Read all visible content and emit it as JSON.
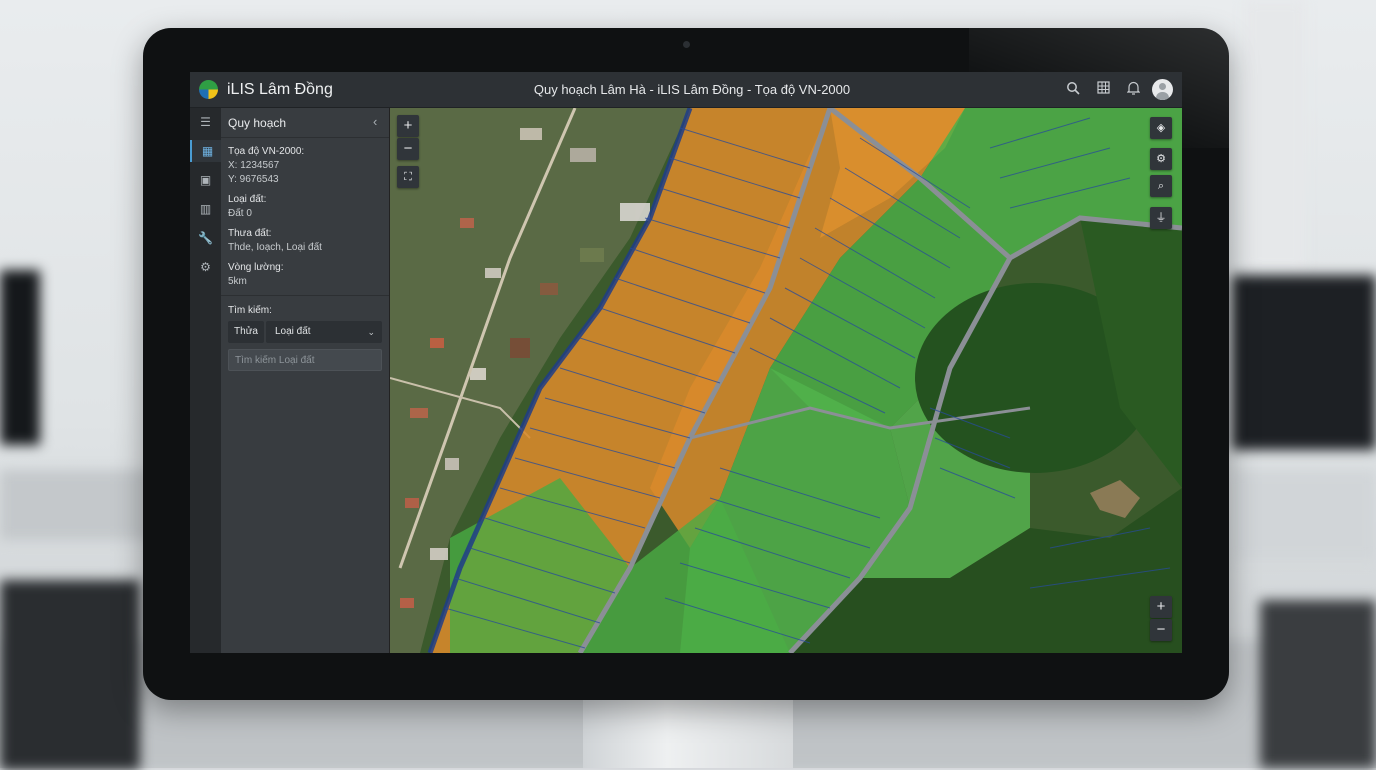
{
  "app": {
    "name": "iLIS Lâm Đồng",
    "window_title": "Quy hoạch Lâm Hà - iLIS Lâm Đồng - Tọa độ VN-2000"
  },
  "topbar_icons": [
    "search-icon",
    "grid-icon",
    "bell-icon",
    "user-avatar"
  ],
  "rail": {
    "items": [
      {
        "icon": "menu-icon",
        "glyph": "☰"
      },
      {
        "icon": "layers-list-icon",
        "glyph": "▦"
      },
      {
        "icon": "image-icon",
        "glyph": "▣"
      },
      {
        "icon": "map-icon",
        "glyph": "▥"
      },
      {
        "icon": "wrench-icon",
        "glyph": "🔧"
      },
      {
        "icon": "gear-icon",
        "glyph": "⚙"
      }
    ]
  },
  "panel": {
    "title": "Quy hoạch",
    "coords_label": "Tọa độ VN-2000:",
    "x_value": "X: 1234567",
    "y_value": "Y: 9676543",
    "land_type_label": "Loại đất:",
    "land_type_value": "Đất 0",
    "parcel_label": "Thưa đất:",
    "parcel_value": "Thde, Ioạch, Loại đất",
    "buffer_label": "Vòng lường:",
    "buffer_value": "5km",
    "search_label": "Tìm kiếm:",
    "filter_button": "Thửa",
    "filter_select": "Loại đất",
    "search_placeholder": "Tìm kiếm Loại đất"
  },
  "map_controls": {
    "zoom_in": "+",
    "zoom_out": "−",
    "fullscreen": "⛶",
    "layers": "◈",
    "tools": "⚙",
    "search": "⌕",
    "measure": "⏚",
    "zoom_in_bottom": "+",
    "zoom_out_bottom": "−"
  },
  "colors": {
    "planned_residential": "#d98a2b",
    "agricultural": "#4fb04a",
    "forest": "#24521f",
    "parcel_boundary": "#274b9a",
    "accent": "#4a9dd4"
  }
}
